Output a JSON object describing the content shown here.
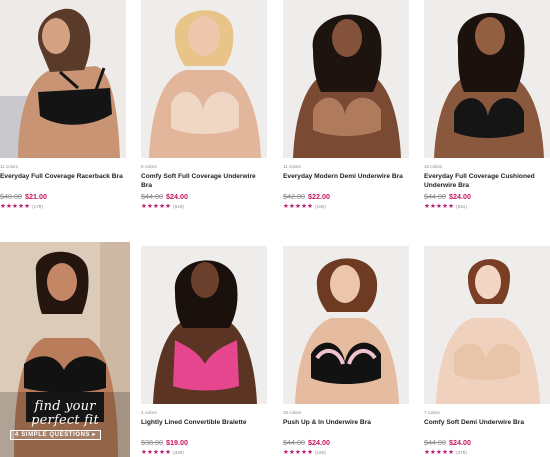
{
  "products": [
    {
      "colors": "11 colors",
      "name": "Everyday Full Coverage Racerback Bra",
      "old_price": "$40.00",
      "price": "$21.00",
      "stars": "★★★★★",
      "reviews": "(178)",
      "image": "model-black-racerback-bra"
    },
    {
      "colors": "8 colors",
      "name": "Comfy Soft Full Coverage Underwire Bra",
      "old_price": "$44.00",
      "price": "$24.00",
      "stars": "★★★★★",
      "reviews": "(619)",
      "image": "model-nude-underwire-bra"
    },
    {
      "colors": "11 colors",
      "name": "Everyday Modern Demi Underwire Bra",
      "old_price": "$42.00",
      "price": "$22.00",
      "stars": "★★★★★",
      "reviews": "(180)",
      "image": "model-tan-demi-bra"
    },
    {
      "colors": "10 colors",
      "name": "Everyday Full Coverage Cushioned Underwire Bra",
      "old_price": "$44.00",
      "price": "$24.00",
      "stars": "★★★★★",
      "reviews": "(551)",
      "image": "model-black-lace-bra"
    },
    {
      "colors": "4 colors",
      "name": "Lightly Lined Convertible Bralette",
      "old_price": "$38.00",
      "price": "$19.00",
      "stars": "★★★★★",
      "reviews": "(449)",
      "image": "model-pink-lace-bralette"
    },
    {
      "colors": "16 colors",
      "name": "Push Up & In Underwire Bra",
      "old_price": "$44.00",
      "price": "$24.00",
      "stars": "★★★★★",
      "reviews": "(160)",
      "image": "model-black-pink-pushup-bra"
    },
    {
      "colors": "7 colors",
      "name": "Comfy Soft Demi Underwire Bra",
      "old_price": "$44.00",
      "price": "$24.00",
      "stars": "★★★★★",
      "reviews": "(378)",
      "image": "model-nude-demi-bra"
    }
  ],
  "promo": {
    "title_line1": "find your",
    "title_line2": "perfect fit",
    "button": "4 SIMPLE QUESTIONS ▸",
    "image": "model-black-strapless-bra"
  },
  "colors": {
    "sale": "#c7165f",
    "stars": "#b5176e"
  }
}
